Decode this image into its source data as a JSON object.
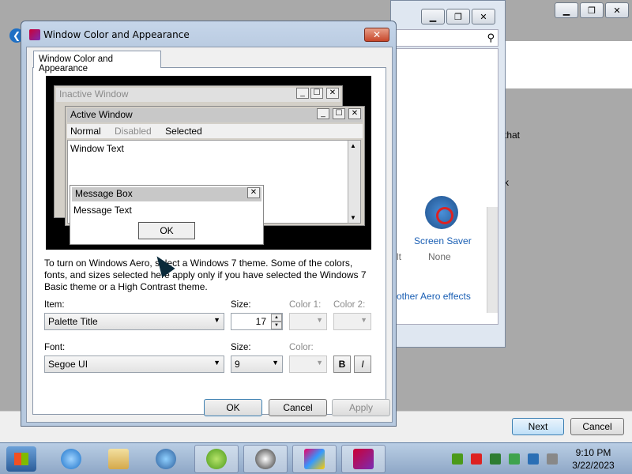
{
  "background": {
    "fragments": {
      "that": "that",
      "k": "k"
    },
    "next_label": "Next",
    "cancel_label": "Cancel"
  },
  "control_panel": {
    "screen_saver_label": "Screen Saver",
    "screen_saver_value": "None",
    "aero_link": "other Aero effects",
    "lt_fragment": "lt"
  },
  "dialog": {
    "title": "Window Color and Appearance",
    "tab_label": "Window Color and Appearance",
    "close_glyph": "✕",
    "preview": {
      "inactive_title": "Inactive Window",
      "active_title": "Active Window",
      "menu": [
        "Normal",
        "Disabled",
        "Selected"
      ],
      "window_text": "Window Text",
      "msgbox_title": "Message Box",
      "msgbox_text": "Message Text",
      "ok_label": "OK"
    },
    "description": "To turn on Windows Aero, select a Windows 7 theme.  Some of the colors, fonts, and sizes selected here apply only if you have selected the Windows 7 Basic theme or a High Contrast theme.",
    "item_label": "Item:",
    "item_value": "Palette Title",
    "size_label": "Size:",
    "item_size_value": "17",
    "color1_label": "Color 1:",
    "color2_label": "Color 2:",
    "font_label": "Font:",
    "font_value": "Segoe UI",
    "font_size_label": "Size:",
    "font_size_value": "9",
    "color_label": "Color:",
    "bold_label": "B",
    "italic_label": "I",
    "ok_label": "OK",
    "cancel_label": "Cancel",
    "apply_label": "Apply"
  },
  "taskbar": {
    "time": "9:10 PM",
    "date": "3/22/2023"
  }
}
